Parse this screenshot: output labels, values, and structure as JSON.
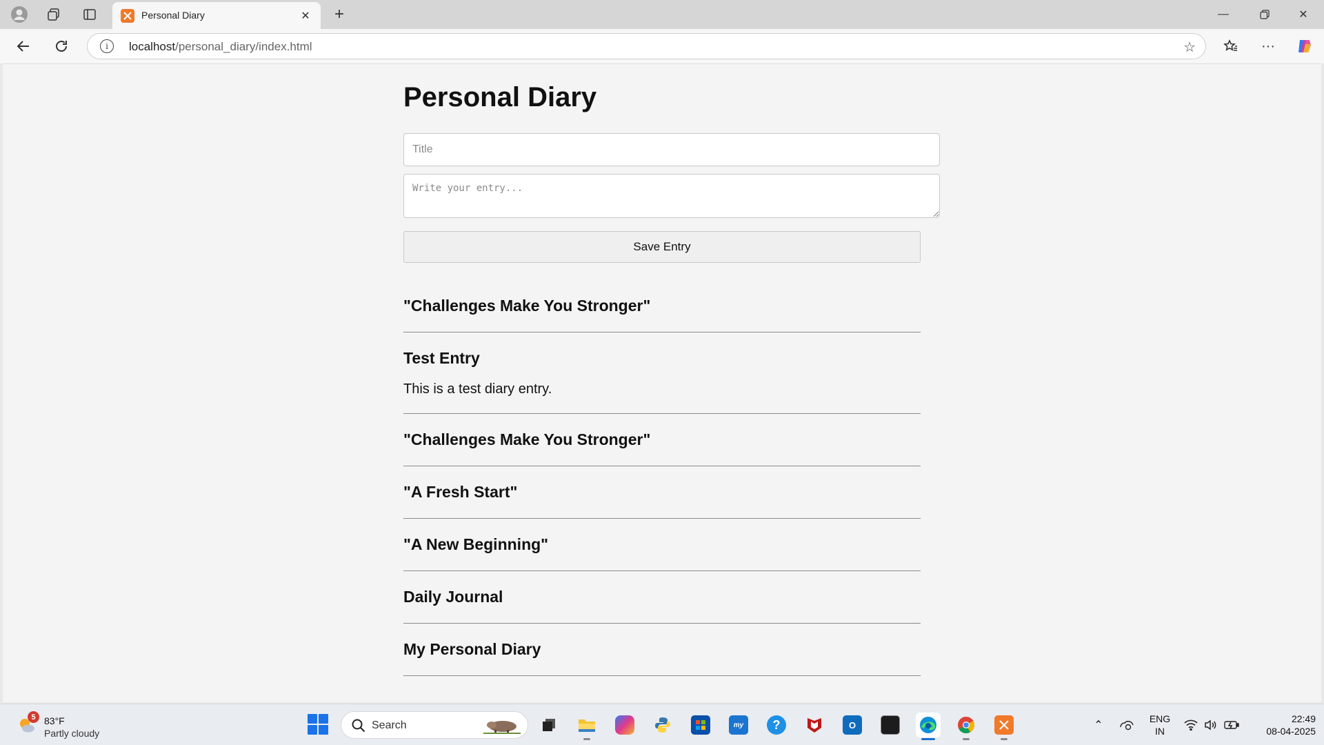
{
  "browser": {
    "tab_title": "Personal Diary",
    "url_host": "localhost",
    "url_path": "/personal_diary/index.html"
  },
  "page": {
    "title": "Personal Diary",
    "title_placeholder": "Title",
    "entry_placeholder": "Write your entry...",
    "save_label": "Save Entry",
    "entries": [
      {
        "title": "\"Challenges Make You Stronger\"",
        "body": ""
      },
      {
        "title": "Test Entry",
        "body": "This is a test diary entry."
      },
      {
        "title": "\"Challenges Make You Stronger\"",
        "body": ""
      },
      {
        "title": "\"A Fresh Start\"",
        "body": ""
      },
      {
        "title": "\"A New Beginning\"",
        "body": ""
      },
      {
        "title": "Daily Journal",
        "body": ""
      },
      {
        "title": "My Personal Diary",
        "body": ""
      }
    ]
  },
  "taskbar": {
    "weather_badge": "5",
    "weather_temp": "83°F",
    "weather_desc": "Partly cloudy",
    "search_label": "Search",
    "lang_top": "ENG",
    "lang_bottom": "IN",
    "time": "22:49",
    "date": "08-04-2025",
    "apps": [
      "task-view",
      "file-explorer",
      "copilot",
      "python",
      "microsoft-store",
      "myhp",
      "help",
      "mcafee",
      "outlook",
      "terminal",
      "edge",
      "chrome",
      "xampp"
    ]
  }
}
